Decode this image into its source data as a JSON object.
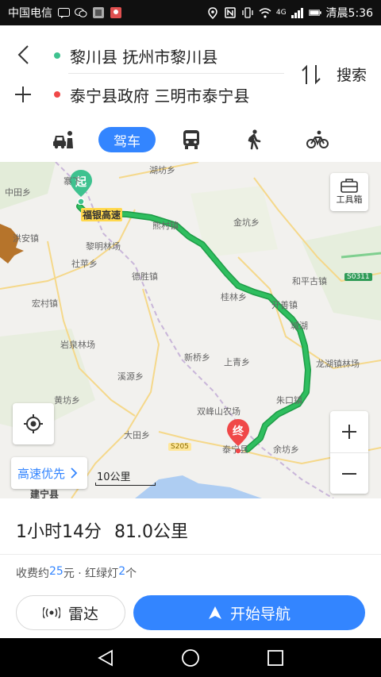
{
  "status_bar": {
    "carrier": "中国电信",
    "signal_text": "4G",
    "time": "清晨5:36"
  },
  "route": {
    "start": "黎川县 抚州市黎川县",
    "end": "泰宁县政府 三明市泰宁县",
    "search_label": "搜索",
    "start_color": "#3ec28f",
    "end_color": "#f04848"
  },
  "modes": {
    "drive_label": "驾车",
    "items": [
      "taxi-icon",
      "car",
      "bus-icon",
      "walk-icon",
      "bike-icon"
    ],
    "active_color": "#3385ff"
  },
  "map": {
    "toolbox_label": "工具箱",
    "start_marker": "起",
    "end_marker": "终",
    "road_name": "福银高速",
    "route_color": "#2fbe5f",
    "highway_tag": "S0311",
    "yellow_tag": "S205",
    "labels": {
      "l1": "湖坊乡",
      "l2": "中田乡",
      "l3": "熊村镇",
      "l4": "金坑乡",
      "l5": "洪安镇",
      "l6": "黎明林场",
      "l7": "社苹乡",
      "l8": "德胜镇",
      "l9": "和平古镇",
      "l10": "宏村镇",
      "l11": "桂林乡",
      "l12": "开善镇",
      "l13": "岩泉林场",
      "l14": "新桥乡",
      "l15": "上青乡",
      "l16": "龙湖镇林场",
      "l17": "溪源乡",
      "l18": "黄坊乡",
      "l19": "朱口镇",
      "l20": "双峰山农场",
      "l21": "大田乡",
      "l22": "泰宁县",
      "l23": "余坊乡",
      "l24": "建宁县",
      "l25": "寨下",
      "l26": "城湖"
    },
    "prefer_label": "高速优先",
    "scale_label": "10公里"
  },
  "summary": {
    "duration": "1小时14分",
    "distance": "81.0公里",
    "fee_prefix": "收费约",
    "fee_value": "25",
    "fee_unit": "元 · 红绿灯",
    "lights_value": "2",
    "lights_unit": "个"
  },
  "actions": {
    "radar_label": "雷达",
    "navigate_label": "开始导航"
  }
}
